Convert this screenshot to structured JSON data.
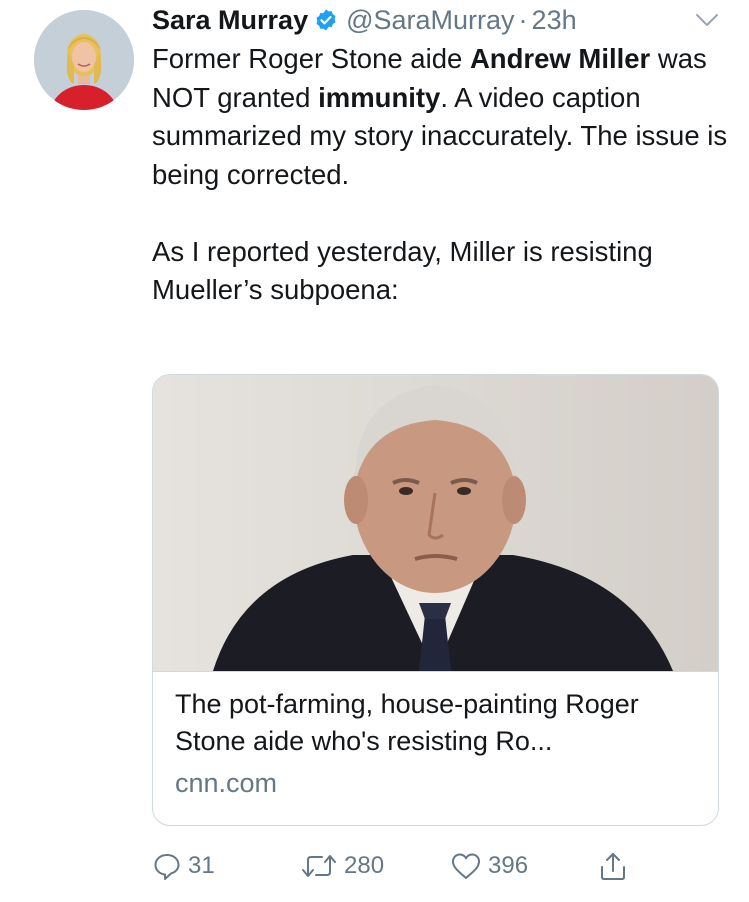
{
  "tweet": {
    "display_name": "Sara Murray",
    "handle": "@SaraMurray",
    "separator": "·",
    "time": "23h",
    "verified": true,
    "text": {
      "p1_a": "Former Roger Stone aide ",
      "p1_b": "Andrew Miller",
      "p1_c": " was NOT granted ",
      "p1_d": "immunity",
      "p1_e": ". A video caption summarized my story inaccurately. The issue is being corrected.",
      "p2": "As I reported yesterday, Miller is resisting Mueller’s subpoena:"
    },
    "card": {
      "title": "The pot-farming, house-painting Roger Stone aide who's resisting Ro...",
      "domain": "cnn.com"
    },
    "actions": {
      "replies": "31",
      "retweets": "280",
      "likes": "396"
    }
  },
  "icons": {
    "verified": "verified-badge-icon",
    "caret": "chevron-down-icon",
    "reply": "reply-icon",
    "retweet": "retweet-icon",
    "like": "heart-icon",
    "share": "share-icon"
  },
  "colors": {
    "verified_blue": "#1da1f2",
    "secondary_text": "#657786",
    "primary_text": "#14171a",
    "card_border": "#cfd9de"
  }
}
